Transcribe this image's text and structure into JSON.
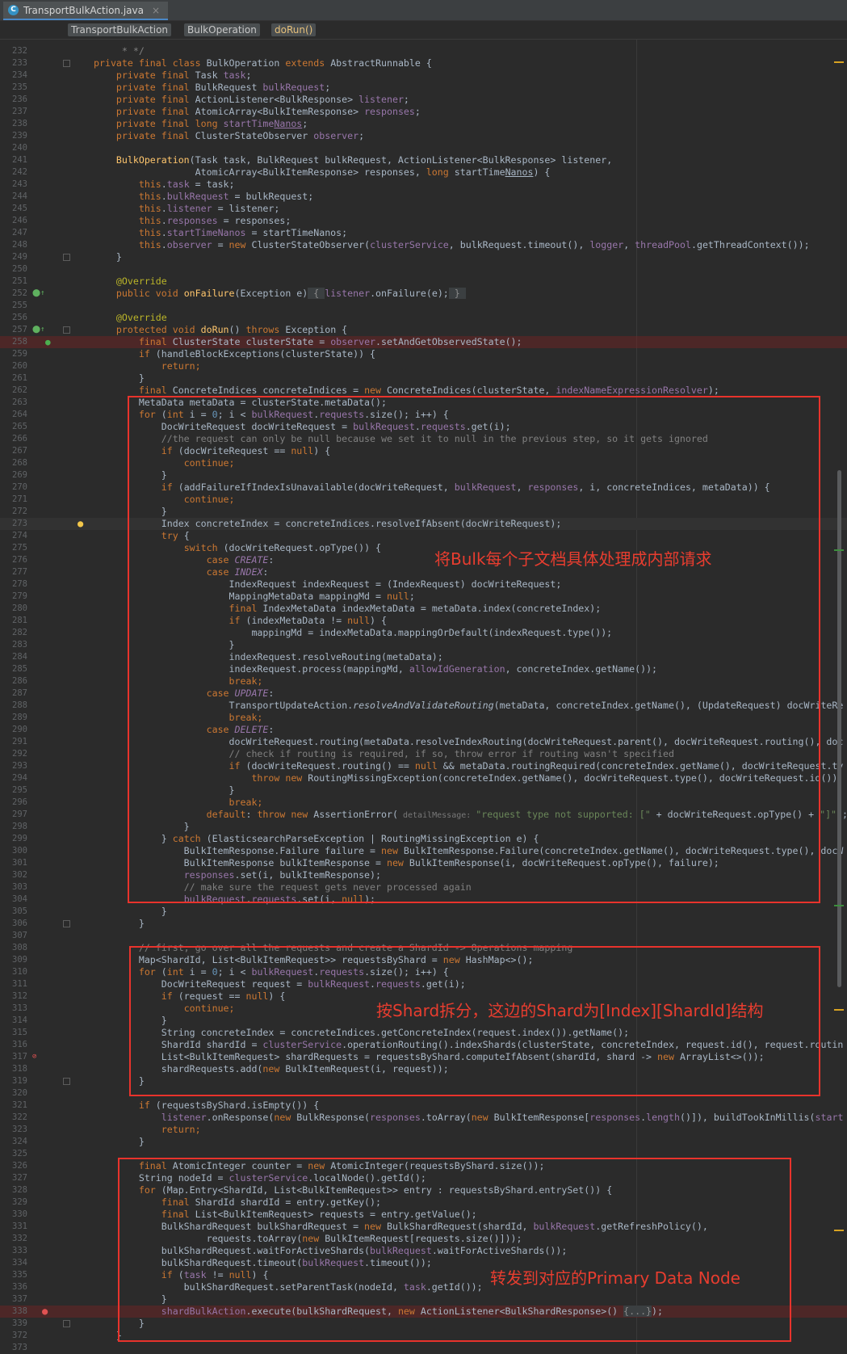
{
  "tab": {
    "file_name": "TransportBulkAction.java",
    "close_glyph": "×",
    "file_icon_letter": "C"
  },
  "breadcrumb": [
    "TransportBulkAction",
    "BulkOperation",
    "doRun()"
  ],
  "annotations": {
    "box1": "将Bulk每个子文档具体处理成内部请求",
    "box2": "按Shard拆分，这边的Shard为[Index][ShardId]结构",
    "box3": "转发到对应的Primary Data Node"
  },
  "code_lines": [
    {
      "n": "232",
      "t": "[c]     * */[/c]"
    },
    {
      "n": "233",
      "t": "[k]private final class [/k]BulkOperation [k]extends [/k]AbstractRunnable {"
    },
    {
      "n": "234",
      "t": "    [k]private final [/k]Task [f]task[/f];"
    },
    {
      "n": "235",
      "t": "    [k]private final [/k]BulkRequest [f]bulkRequest[/f];"
    },
    {
      "n": "236",
      "t": "    [k]private final [/k]ActionListener<BulkResponse> [f]listener[/f];"
    },
    {
      "n": "237",
      "t": "    [k]private final [/k]AtomicArray<BulkItemResponse> [f]responses[/f];"
    },
    {
      "n": "238",
      "t": "    [k]private final long [/k][f]startTime[u]Nanos[/u][/f];"
    },
    {
      "n": "239",
      "t": "    [k]private final [/k]ClusterStateObserver [f]observer[/f];"
    },
    {
      "n": "240",
      "t": ""
    },
    {
      "n": "241",
      "t": "    [m]BulkOperation[/m](Task task, BulkRequest bulkRequest, ActionListener<BulkResponse> listener,"
    },
    {
      "n": "242",
      "t": "                  AtomicArray<BulkItemResponse> responses, [k]long [/k]startTime[u]Nanos[/u]) {"
    },
    {
      "n": "243",
      "t": "        [k]this[/k].[f]task [/f]= task;"
    },
    {
      "n": "244",
      "t": "        [k]this[/k].[f]bulkRequest [/f]= bulkRequest;"
    },
    {
      "n": "245",
      "t": "        [k]this[/k].[f]listener [/f]= listener;"
    },
    {
      "n": "246",
      "t": "        [k]this[/k].[f]responses [/f]= responses;"
    },
    {
      "n": "247",
      "t": "        [k]this[/k].[f]startTimeNanos [/f]= startTimeNanos;"
    },
    {
      "n": "248",
      "t": "        [k]this[/k].[f]observer [/f]= [k]new [/k]ClusterStateObserver([f]clusterService[/f], bulkRequest.timeout(), [f]logger[/f], [f]threadPool[/f].getThreadContext());"
    },
    {
      "n": "249",
      "t": "    }"
    },
    {
      "n": "250",
      "t": ""
    },
    {
      "n": "251",
      "t": "    [a]@Override[/a]"
    },
    {
      "n": "252",
      "t": "    [k]public void [/k][m]onFailure[/m](Exception e)[g] { [/g][f]listener[/f].onFailure(e);[g] } [/g]"
    },
    {
      "n": "255",
      "t": ""
    },
    {
      "n": "256",
      "t": "    [a]@Override[/a]"
    },
    {
      "n": "257",
      "t": "    [k]protected void [/k][m]doRun[/m]() [k]throws [/k]Exception {"
    },
    {
      "n": "258",
      "t": "        [k]final [/k]ClusterState clusterState = [f]observer[/f].setAndGetObservedState();"
    },
    {
      "n": "259",
      "t": "        [k]if [/k](handleBlockExceptions(clusterState)) {"
    },
    {
      "n": "260",
      "t": "            [k]return;[/k]"
    },
    {
      "n": "261",
      "t": "        }"
    },
    {
      "n": "262",
      "t": "        [k]final [/k]ConcreteIndices concreteIndices = [k]new [/k]ConcreteIndices(clusterState, [f]indexNameExpressionResolver[/f]);"
    },
    {
      "n": "263",
      "t": "        MetaData metaData = clusterState.metaData();"
    },
    {
      "n": "264",
      "t": "        [k]for [/k]([k]int [/k]i = [n]0[/n]; i < [f]bulkRequest[/f].[f]requests[/f].size(); i++) {"
    },
    {
      "n": "265",
      "t": "            DocWriteRequest docWriteRequest = [f]bulkRequest[/f].[f]requests[/f].get(i);"
    },
    {
      "n": "266",
      "t": "            [c]//the request can only be null because we set it to null in the previous step, so it gets ignored[/c]"
    },
    {
      "n": "267",
      "t": "            [k]if [/k](docWriteRequest == [k]null[/k]) {"
    },
    {
      "n": "268",
      "t": "                [k]continue;[/k]"
    },
    {
      "n": "269",
      "t": "            }"
    },
    {
      "n": "270",
      "t": "            [k]if [/k](addFailureIfIndexIsUnavailable(docWriteRequest, [f]bulkRequest[/f], [f]responses[/f], i, concreteIndices, metaData)) {"
    },
    {
      "n": "271",
      "t": "                [k]continue;[/k]"
    },
    {
      "n": "272",
      "t": "            }"
    },
    {
      "n": "273",
      "t": "            Index concreteIndex = concreteIndices.resolveIfAbsent(docWriteRequest);"
    },
    {
      "n": "274",
      "t": "            [k]try [/k]{"
    },
    {
      "n": "275",
      "t": "                [k]switch [/k](docWriteRequest.opType()) {"
    },
    {
      "n": "276",
      "t": "                    [k]case [/k][f][i]CREATE[/i][/f]:"
    },
    {
      "n": "277",
      "t": "                    [k]case [/k][f][i]INDEX[/i][/f]:"
    },
    {
      "n": "278",
      "t": "                        IndexRequest indexRequest = (IndexRequest) docWriteRequest;"
    },
    {
      "n": "279",
      "t": "                        MappingMetaData mappingMd = [k]null[/k];"
    },
    {
      "n": "280",
      "t": "                        [k]final [/k]IndexMetaData indexMetaData = metaData.index(concreteIndex);"
    },
    {
      "n": "281",
      "t": "                        [k]if [/k](indexMetaData != [k]null[/k]) {"
    },
    {
      "n": "282",
      "t": "                            mappingMd = indexMetaData.mappingOrDefault(indexRequest.type());"
    },
    {
      "n": "283",
      "t": "                        }"
    },
    {
      "n": "284",
      "t": "                        indexRequest.resolveRouting(metaData);"
    },
    {
      "n": "285",
      "t": "                        indexRequest.process(mappingMd, [f]allowIdGeneration[/f], concreteIndex.getName());"
    },
    {
      "n": "286",
      "t": "                        [k]break;[/k]"
    },
    {
      "n": "287",
      "t": "                    [k]case [/k][f][i]UPDATE[/i][/f]:"
    },
    {
      "n": "288",
      "t": "                        TransportUpdateAction.[i]resolveAndValidateRouting[/i](metaData, concreteIndex.getName(), (UpdateRequest) docWriteRe"
    },
    {
      "n": "289",
      "t": "                        [k]break;[/k]"
    },
    {
      "n": "290",
      "t": "                    [k]case [/k][f][i]DELETE[/i][/f]:"
    },
    {
      "n": "291",
      "t": "                        docWriteRequest.routing(metaData.resolveIndexRouting(docWriteRequest.parent(), docWriteRequest.routing(), doc"
    },
    {
      "n": "292",
      "t": "                        [c]// check if routing is required, if so, throw error if routing wasn't specified[/c]"
    },
    {
      "n": "293",
      "t": "                        [k]if [/k](docWriteRequest.routing() == [k]null [/k]&& metaData.routingRequired(concreteIndex.getName(), docWriteRequest.ty"
    },
    {
      "n": "294",
      "t": "                            [k]throw new [/k]RoutingMissingException(concreteIndex.getName(), docWriteRequest.type(), docWriteRequest.id());"
    },
    {
      "n": "295",
      "t": "                        }"
    },
    {
      "n": "296",
      "t": "                        [k]break;[/k]"
    },
    {
      "n": "297",
      "t": "                    [k]default[/k]: [k]throw new [/k]AssertionError([h] detailMessage: [/h][s]\"request type not supported: [\" [/s]+ docWriteRequest.opType() + [s]\"]\"[/s]);"
    },
    {
      "n": "298",
      "t": "                }"
    },
    {
      "n": "299",
      "t": "            } [k]catch [/k](ElasticsearchParseException | RoutingMissingException e) {"
    },
    {
      "n": "300",
      "t": "                BulkItemResponse.Failure failure = [k]new [/k]BulkItemResponse.Failure(concreteIndex.getName(), docWriteRequest.type(), docW"
    },
    {
      "n": "301",
      "t": "                BulkItemResponse bulkItemResponse = [k]new [/k]BulkItemResponse(i, docWriteRequest.opType(), failure);"
    },
    {
      "n": "302",
      "t": "                [f]responses[/f].set(i, bulkItemResponse);"
    },
    {
      "n": "303",
      "t": "                [c]// make sure the request gets never processed again[/c]"
    },
    {
      "n": "304",
      "t": "                [f]bulkRequest[/f].[f]requests[/f].set(i, [k]null[/k]);"
    },
    {
      "n": "305",
      "t": "            }"
    },
    {
      "n": "306",
      "t": "        }"
    },
    {
      "n": "307",
      "t": ""
    },
    {
      "n": "308",
      "t": "        [c]// first, go over all the requests and create a ShardId -> Operations mapping[/c]"
    },
    {
      "n": "309",
      "t": "        Map<ShardId, List<BulkItemRequest>> requestsByShard = [k]new [/k]HashMap<>();"
    },
    {
      "n": "310",
      "t": "        [k]for [/k]([k]int [/k]i = [n]0[/n]; i < [f]bulkRequest[/f].[f]requests[/f].size(); i++) {"
    },
    {
      "n": "311",
      "t": "            DocWriteRequest request = [f]bulkRequest[/f].[f]requests[/f].get(i);"
    },
    {
      "n": "312",
      "t": "            [k]if [/k](request == [k]null[/k]) {"
    },
    {
      "n": "313",
      "t": "                [k]continue;[/k]"
    },
    {
      "n": "314",
      "t": "            }"
    },
    {
      "n": "315",
      "t": "            String concreteIndex = concreteIndices.getConcreteIndex(request.index()).getName();"
    },
    {
      "n": "316",
      "t": "            ShardId shardId = [f]clusterService[/f].operationRouting().indexShards(clusterState, concreteIndex, request.id(), request.routin"
    },
    {
      "n": "317",
      "t": "            List<BulkItemRequest> shardRequests = requestsByShard.computeIfAbsent(shardId, shard -> [k]new [/k]ArrayList<>());"
    },
    {
      "n": "318",
      "t": "            shardRequests.add([k]new [/k]BulkItemRequest(i, request));"
    },
    {
      "n": "319",
      "t": "        }"
    },
    {
      "n": "320",
      "t": ""
    },
    {
      "n": "321",
      "t": "        [k]if [/k](requestsByShard.isEmpty()) {"
    },
    {
      "n": "322",
      "t": "            [f]listener[/f].onResponse([k]new [/k]BulkResponse([f]responses[/f].toArray([k]new [/k]BulkItemResponse[[f]responses[/f].[f]length[/f]()]), buildTookInMillis([f]start[/f]"
    },
    {
      "n": "323",
      "t": "            [k]return;[/k]"
    },
    {
      "n": "324",
      "t": "        }"
    },
    {
      "n": "325",
      "t": ""
    },
    {
      "n": "326",
      "t": "        [k]final [/k]AtomicInteger counter = [k]new [/k]AtomicInteger(requestsByShard.size());"
    },
    {
      "n": "327",
      "t": "        String nodeId = [f]clusterService[/f].localNode().getId();"
    },
    {
      "n": "328",
      "t": "        [k]for [/k](Map.Entry<ShardId, List<BulkItemRequest>> entry : requestsByShard.entrySet()) {"
    },
    {
      "n": "329",
      "t": "            [k]final [/k]ShardId shardId = entry.getKey();"
    },
    {
      "n": "330",
      "t": "            [k]final [/k]List<BulkItemRequest> requests = entry.getValue();"
    },
    {
      "n": "331",
      "t": "            BulkShardRequest bulkShardRequest = [k]new [/k]BulkShardRequest(shardId, [f]bulkRequest[/f].getRefreshPolicy(),"
    },
    {
      "n": "332",
      "t": "                    requests.toArray([k]new [/k]BulkItemRequest[requests.size()]));"
    },
    {
      "n": "333",
      "t": "            bulkShardRequest.waitForActiveShards([f]bulkRequest[/f].waitForActiveShards());"
    },
    {
      "n": "334",
      "t": "            bulkShardRequest.timeout([f]bulkRequest[/f].timeout());"
    },
    {
      "n": "335",
      "t": "            [k]if [/k]([f]task [/f]!= [k]null[/k]) {"
    },
    {
      "n": "336",
      "t": "                bulkShardRequest.setParentTask(nodeId, [f]task[/f].getId());"
    },
    {
      "n": "337",
      "t": "            }"
    },
    {
      "n": "338",
      "t": "            [f]shardBulkAction[/f].execute(bulkShardRequest, [k]new [/k]ActionListener<BulkShardResponse>() [g]{...}[/g]);"
    },
    {
      "n": "339",
      "t": "        }"
    },
    {
      "n": "372",
      "t": "    }"
    },
    {
      "n": "373",
      "t": ""
    }
  ]
}
